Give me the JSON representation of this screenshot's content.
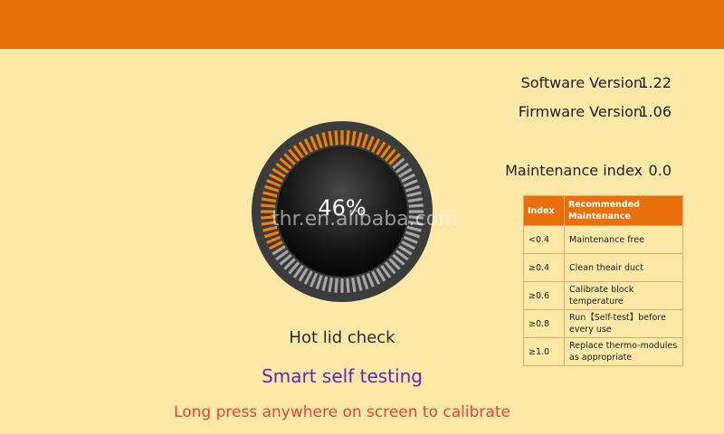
{
  "header": {
    "color": "#e96f0a"
  },
  "versions": {
    "software_label": "Software Version",
    "software_value": "1.22",
    "firmware_label": "Firmware Version",
    "firmware_value": "1.06",
    "maint_label": "Maintenance index",
    "maint_value": "0.0"
  },
  "gauge": {
    "percent_text": "46%",
    "progress": 0.46,
    "active_color": "#f07f0d",
    "inactive_color": "#a6a6a6"
  },
  "watermark": "thr.en.alibaba.com",
  "status": {
    "check": "Hot lid check",
    "mode": "Smart self testing",
    "hint": "Long press anywhere on screen to calibrate"
  },
  "table": {
    "headers": [
      "Index",
      "Recommended Maintenance"
    ],
    "rows": [
      [
        "<0.4",
        "Maintenance free"
      ],
      [
        "≥0.4",
        "Clean theair duct"
      ],
      [
        "≥0.6",
        "Calibrate block temperature"
      ],
      [
        "≥0.8",
        "Run【Self-test】before every use"
      ],
      [
        "≥1.0",
        "Replace thermo-modules as appropriate"
      ]
    ]
  }
}
